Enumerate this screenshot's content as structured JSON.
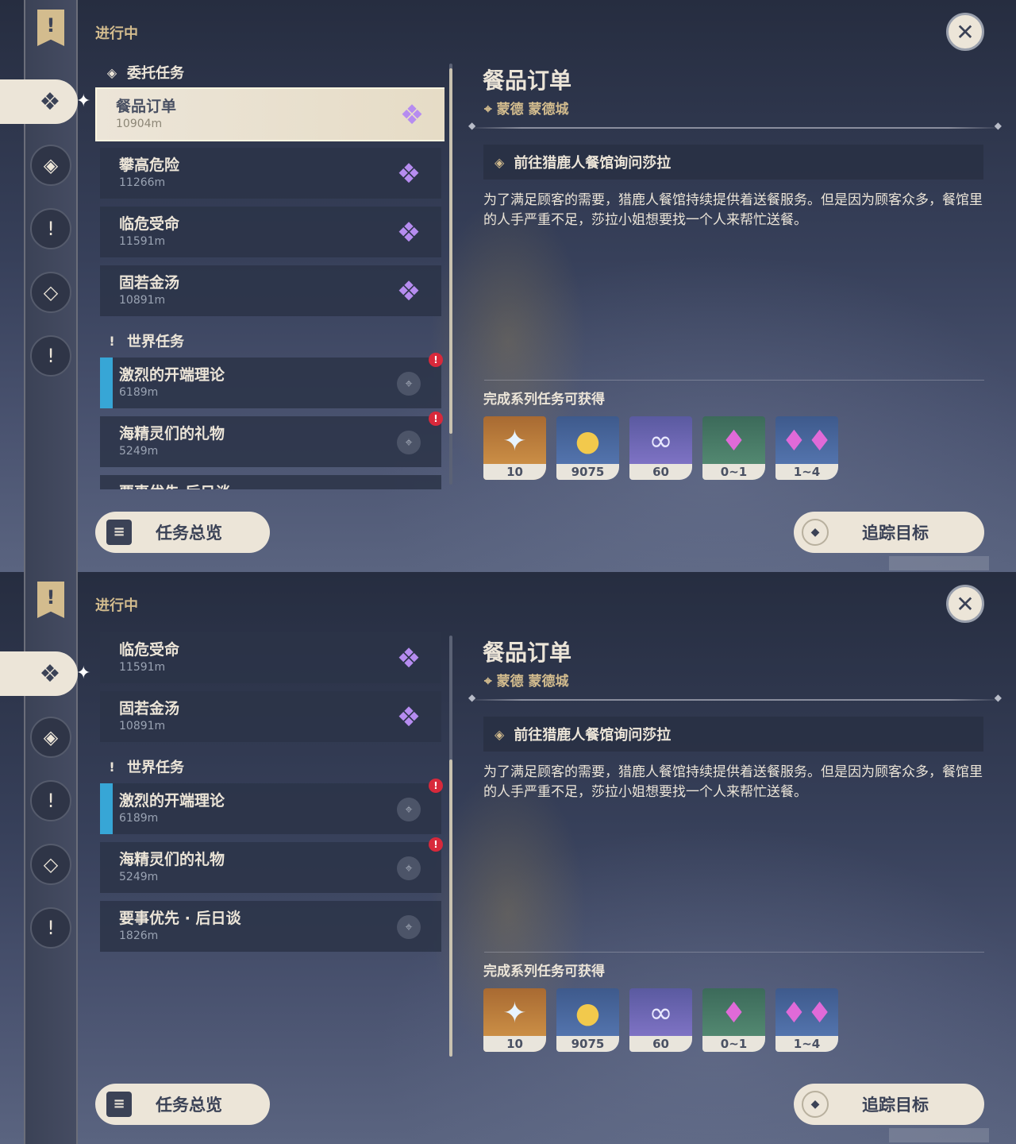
{
  "screens": [
    {
      "header_label": "进行中",
      "close_label": "✕",
      "sections": [
        {
          "title": "委托任务",
          "icon": "commission-diamond-icon"
        },
        {
          "title": "世界任务",
          "icon": "world-quest-exclaim-icon"
        }
      ],
      "quests": [
        {
          "name": "餐品订单",
          "distance": "10904m",
          "selected": true,
          "kind": "commission"
        },
        {
          "name": "攀高危险",
          "distance": "11266m",
          "kind": "commission"
        },
        {
          "name": "临危受命",
          "distance": "11591m",
          "kind": "commission"
        },
        {
          "name": "固若金汤",
          "distance": "10891m",
          "kind": "commission"
        },
        {
          "name": "激烈的开端理论",
          "distance": "6189m",
          "kind": "world",
          "tracked": true,
          "alert": true
        },
        {
          "name": "海精灵们的礼物",
          "distance": "5249m",
          "kind": "world",
          "alert": true
        },
        {
          "name": "要事优先·后日谈",
          "distance": "",
          "kind": "world"
        }
      ],
      "detail": {
        "title": "餐品订单",
        "location": "蒙德 蒙德城",
        "objective": "前往猎鹿人餐馆询问莎拉",
        "description": "为了满足顾客的需要，猎鹿人餐馆持续提供着送餐服务。但是因为顾客众多，餐馆里的人手严重不足，莎拉小姐想要找一个人来帮忙送餐。",
        "rewards_label": "完成系列任务可获得",
        "rewards": [
          {
            "count": "10",
            "icon": "primogem-icon",
            "color": "orange"
          },
          {
            "count": "9075",
            "icon": "mora-coin-icon",
            "color": "blue"
          },
          {
            "count": "60",
            "icon": "adventure-exp-icon",
            "color": "purple"
          },
          {
            "count": "0~1",
            "icon": "crystal-icon",
            "color": "green"
          },
          {
            "count": "1~4",
            "icon": "crystal-cluster-icon",
            "color": "blue"
          }
        ]
      },
      "buttons": {
        "overview": "任务总览",
        "track": "追踪目标"
      }
    },
    {
      "header_label": "进行中",
      "close_label": "✕",
      "sections": [
        {
          "title": "世界任务",
          "icon": "world-quest-exclaim-icon"
        }
      ],
      "quests": [
        {
          "name": "临危受命",
          "distance": "11591m",
          "kind": "commission"
        },
        {
          "name": "固若金汤",
          "distance": "10891m",
          "kind": "commission"
        },
        {
          "name": "激烈的开端理论",
          "distance": "6189m",
          "kind": "world",
          "tracked": true,
          "alert": true
        },
        {
          "name": "海精灵们的礼物",
          "distance": "5249m",
          "kind": "world",
          "alert": true
        },
        {
          "name": "要事优先 · 后日谈",
          "distance": "1826m",
          "kind": "world"
        }
      ],
      "detail": {
        "title": "餐品订单",
        "location": "蒙德 蒙德城",
        "objective": "前往猎鹿人餐馆询问莎拉",
        "description": "为了满足顾客的需要，猎鹿人餐馆持续提供着送餐服务。但是因为顾客众多，餐馆里的人手严重不足，莎拉小姐想要找一个人来帮忙送餐。",
        "rewards_label": "完成系列任务可获得",
        "rewards": [
          {
            "count": "10",
            "icon": "primogem-icon",
            "color": "orange"
          },
          {
            "count": "9075",
            "icon": "mora-coin-icon",
            "color": "blue"
          },
          {
            "count": "60",
            "icon": "adventure-exp-icon",
            "color": "purple"
          },
          {
            "count": "0~1",
            "icon": "crystal-icon",
            "color": "green"
          },
          {
            "count": "1~4",
            "icon": "crystal-cluster-icon",
            "color": "blue"
          }
        ]
      },
      "buttons": {
        "overview": "任务总览",
        "track": "追踪目标"
      }
    }
  ],
  "colors": {
    "accent": "#d3bc8e",
    "commission_mark": "#b68cf0",
    "track_bar": "#37a6d6",
    "alert": "#d8293b"
  }
}
